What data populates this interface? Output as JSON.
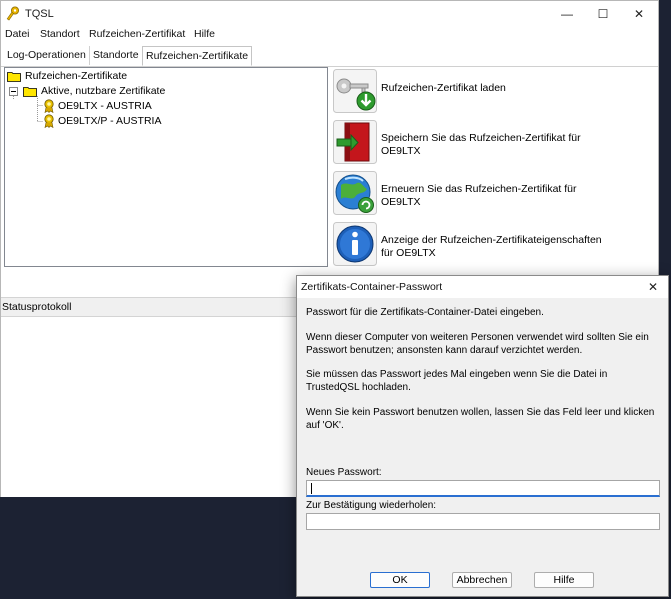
{
  "window": {
    "title": "TQSL",
    "controls": {
      "minimize": "—",
      "maximize": "☐",
      "close": "✕"
    }
  },
  "menu": [
    "Datei",
    "Standort",
    "Rufzeichen-Zertifikat",
    "Hilfe"
  ],
  "tabs": [
    "Log-Operationen",
    "Standorte",
    "Rufzeichen-Zertifikate"
  ],
  "active_tab": "Rufzeichen-Zertifikate",
  "tree": {
    "root": "Rufzeichen-Zertifikate",
    "group": "Aktive, nutzbare Zertifikate",
    "items": [
      "OE9LTX - AUSTRIA",
      "OE9LTX/P - AUSTRIA"
    ]
  },
  "actions": [
    {
      "icon": "certificate-download-icon",
      "label": "Rufzeichen-Zertifikat laden"
    },
    {
      "icon": "save-certificate-icon",
      "label": "Speichern Sie das Rufzeichen-Zertifikat für OE9LTX"
    },
    {
      "icon": "renew-globe-icon",
      "label": "Erneuern Sie das Rufzeichen-Zertifikat für OE9LTX"
    },
    {
      "icon": "info-icon",
      "label": "Anzeige der Rufzeichen-Zertifikateigenschaften für OE9LTX"
    }
  ],
  "status": {
    "title": "Statusprotokoll"
  },
  "dialog": {
    "title": "Zertifikats-Container-Passwort",
    "close": "✕",
    "para1": "Passwort für die Zertifikats-Container-Datei eingeben.",
    "para2": "Wenn dieser Computer von weiteren Personen verwendet wird sollten Sie ein Passwort benutzen; ansonsten kann darauf verzichtet werden.",
    "para3": "Sie müssen das Passwort jedes Mal eingeben wenn Sie die Datei in TrustedQSL hochladen.",
    "para4": "Wenn Sie kein Passwort benutzen wollen, lassen Sie das Feld leer und klicken auf 'OK'.",
    "new_password_label": "Neues Passwort:",
    "new_password_value": "",
    "confirm_label": "Zur Bestätigung wiederholen:",
    "confirm_value": "",
    "buttons": {
      "ok": "OK",
      "cancel": "Abbrechen",
      "help": "Hilfe"
    }
  },
  "colors": {
    "accent": "#2a6fd1",
    "folder": "#ffe600",
    "taskbar": "#1c2233"
  }
}
